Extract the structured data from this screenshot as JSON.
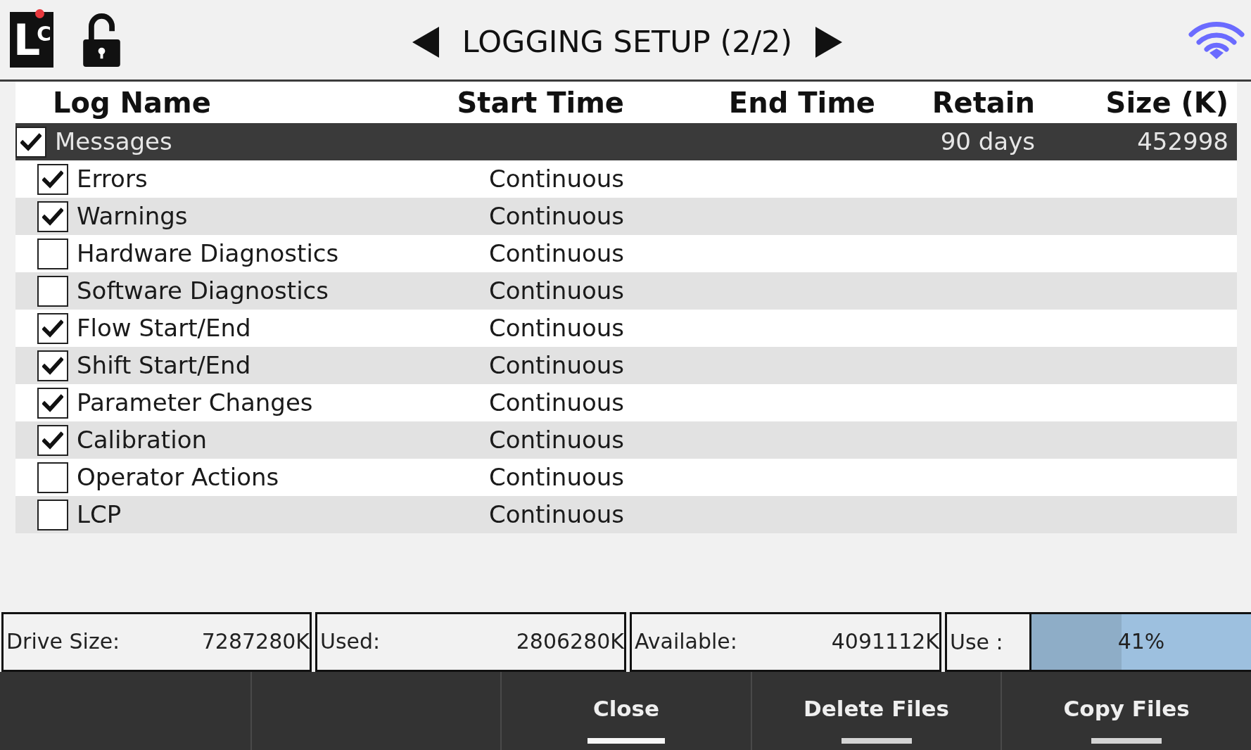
{
  "header": {
    "logo": {
      "letters": [
        "L",
        "C"
      ]
    },
    "locked": false,
    "title": "LOGGING SETUP (2/2)"
  },
  "table": {
    "columns": [
      "Log Name",
      "Start Time",
      "End Time",
      "Retain",
      "Size (K)"
    ],
    "rows": [
      {
        "name": "Messages",
        "checked": true,
        "selected": true,
        "retain": "90 days",
        "size": "452998",
        "children": [
          {
            "name": "Errors",
            "checked": true,
            "selected": false,
            "start_time": "Continuous"
          },
          {
            "name": "Warnings",
            "checked": true,
            "selected": false,
            "start_time": "Continuous"
          },
          {
            "name": "Hardware Diagnostics",
            "checked": false,
            "selected": false,
            "start_time": "Continuous"
          },
          {
            "name": "Software Diagnostics",
            "checked": false,
            "selected": false,
            "start_time": "Continuous"
          },
          {
            "name": "Flow Start/End",
            "checked": true,
            "selected": false,
            "start_time": "Continuous"
          },
          {
            "name": "Shift Start/End",
            "checked": true,
            "selected": false,
            "start_time": "Continuous"
          },
          {
            "name": "Parameter Changes",
            "checked": true,
            "selected": false,
            "start_time": "Continuous"
          },
          {
            "name": "Calibration",
            "checked": true,
            "selected": false,
            "start_time": "Continuous"
          },
          {
            "name": "Operator Actions",
            "checked": false,
            "selected": false,
            "start_time": "Continuous"
          },
          {
            "name": "LCP",
            "checked": false,
            "selected": false,
            "start_time": "Continuous"
          }
        ]
      }
    ]
  },
  "storage": {
    "items": [
      {
        "label": "Drive Size:",
        "value": "7287280K"
      },
      {
        "label": "Used:",
        "value": "2806280K"
      },
      {
        "label": "Available:",
        "value": "4091112K"
      }
    ],
    "usage": {
      "label": "Use :",
      "level": 0.41,
      "reading": "41%"
    }
  },
  "buttons": [
    {
      "label": "Close",
      "selected": true
    },
    {
      "label": "Delete Files",
      "selected": false
    },
    {
      "label": "Copy Files",
      "selected": false
    }
  ]
}
